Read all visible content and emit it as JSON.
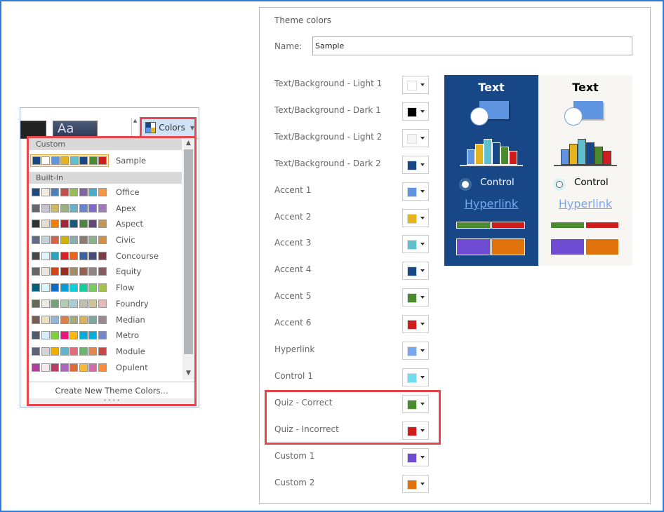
{
  "ribbon": {
    "theme_thumb_text": "Aa",
    "colors_button": "Colors",
    "scroll_up": "▲"
  },
  "dropdown": {
    "custom_header": "Custom",
    "builtin_header": "Built-In",
    "custom": [
      {
        "name": "Sample",
        "colors": [
          "#174787",
          "#ffffff",
          "#5e94e0",
          "#e4b41e",
          "#5fbfcc",
          "#174787",
          "#4a8b30",
          "#cf1c1c"
        ]
      }
    ],
    "builtin": [
      {
        "name": "Office",
        "colors": [
          "#1f497d",
          "#eeece1",
          "#4f81bd",
          "#c0504d",
          "#9bbb59",
          "#8064a2",
          "#4bacc6",
          "#f79646"
        ]
      },
      {
        "name": "Apex",
        "colors": [
          "#69676d",
          "#c9c2d1",
          "#ceb966",
          "#9cb084",
          "#6bb1c9",
          "#6585cf",
          "#7e6bc9",
          "#a379bb"
        ]
      },
      {
        "name": "Aspect",
        "colors": [
          "#323232",
          "#e3ded1",
          "#f07f09",
          "#9f2936",
          "#1b587c",
          "#4e8542",
          "#604878",
          "#c19859"
        ]
      },
      {
        "name": "Civic",
        "colors": [
          "#646b86",
          "#c5d1d7",
          "#d16349",
          "#ccb400",
          "#8cadae",
          "#8c7b70",
          "#8fb08c",
          "#d19049"
        ]
      },
      {
        "name": "Concourse",
        "colors": [
          "#464646",
          "#def5fa",
          "#2da2bf",
          "#da1f28",
          "#eb641b",
          "#39639d",
          "#474b78",
          "#7d3c4a"
        ]
      },
      {
        "name": "Equity",
        "colors": [
          "#696464",
          "#e9e5dc",
          "#d34817",
          "#9b2d1f",
          "#a28e6a",
          "#956251",
          "#918485",
          "#855d5d"
        ]
      },
      {
        "name": "Flow",
        "colors": [
          "#04617b",
          "#dbf5f9",
          "#0f6fc6",
          "#009dd9",
          "#0bd0d9",
          "#10cf9b",
          "#7cca62",
          "#a5c249"
        ]
      },
      {
        "name": "Foundry",
        "colors": [
          "#676a55",
          "#eaebde",
          "#72a376",
          "#b0ccb0",
          "#a8cdd7",
          "#c0beaf",
          "#cec597",
          "#e8b7b7"
        ]
      },
      {
        "name": "Median",
        "colors": [
          "#775f55",
          "#ebddc3",
          "#94b6d2",
          "#dd8047",
          "#a5ab81",
          "#d8b25c",
          "#7ba79d",
          "#968c8c"
        ]
      },
      {
        "name": "Metro",
        "colors": [
          "#4e5b6f",
          "#d6ecff",
          "#7fd13b",
          "#ea157a",
          "#feb80a",
          "#00addc",
          "#00addc",
          "#738ac8"
        ]
      },
      {
        "name": "Module",
        "colors": [
          "#5a6378",
          "#d4d4d4",
          "#f0ad00",
          "#60b5cc",
          "#e66c7d",
          "#6bb76d",
          "#e88651",
          "#c64847"
        ]
      },
      {
        "name": "Opulent",
        "colors": [
          "#b13f9a",
          "#f4e7ed",
          "#b83d68",
          "#ac66bb",
          "#de6c36",
          "#f9b639",
          "#cf6da4",
          "#fa8d3d"
        ]
      }
    ],
    "create_new": "Create New Theme Colors...",
    "scroll_down": "▼",
    "grip": "• • • •"
  },
  "panel": {
    "title": "Theme colors",
    "name_label": "Name:",
    "name_value": "Sample",
    "rows": [
      {
        "label": "Text/Background - Light 1",
        "color": "#ffffff"
      },
      {
        "label": "Text/Background - Dark 1",
        "color": "#000000"
      },
      {
        "label": "Text/Background - Light 2",
        "color": "#f7f6f2"
      },
      {
        "label": "Text/Background - Dark 2",
        "color": "#174787"
      },
      {
        "label": "Accent 1",
        "color": "#5e94e0"
      },
      {
        "label": "Accent 2",
        "color": "#e4b41e"
      },
      {
        "label": "Accent 3",
        "color": "#5fbfcc"
      },
      {
        "label": "Accent 4",
        "color": "#174787"
      },
      {
        "label": "Accent 5",
        "color": "#4a8b30"
      },
      {
        "label": "Accent 6",
        "color": "#cf1c1c"
      },
      {
        "label": "Hyperlink",
        "color": "#7aa6ee"
      },
      {
        "label": "Control 1",
        "color": "#6fdcf0"
      },
      {
        "label": "Quiz - Correct",
        "color": "#4a8b30"
      },
      {
        "label": "Quiz - Incorrect",
        "color": "#cf1c1c"
      },
      {
        "label": "Custom 1",
        "color": "#6f4bd1"
      },
      {
        "label": "Custom 2",
        "color": "#e0720c"
      }
    ]
  },
  "preview": {
    "text": "Text",
    "control": "Control",
    "hyperlink": "Hyperlink",
    "dark_bg": "#174787",
    "light_bg": "#f7f6f2",
    "bar_values": [
      3,
      4,
      5,
      4.3,
      3.5,
      2.7
    ]
  }
}
